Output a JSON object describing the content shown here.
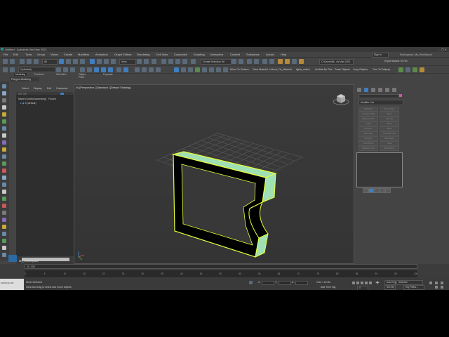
{
  "window": {
    "title": "Untitled - Autodesk 3ds Max 2021",
    "controls": "–  ❐  ✕"
  },
  "menu": {
    "items": [
      "File",
      "Edit",
      "Tools",
      "Group",
      "Views",
      "Create",
      "Modifiers",
      "Animation",
      "Graph Editors",
      "Rendering",
      "Civil View",
      "Customize",
      "Scripting",
      "Interactive",
      "Content",
      "Substance",
      "Arnold",
      "Help"
    ],
    "sign_in": "Sign In",
    "workspaces_label": "Workspaces:",
    "workspace_value": "My_WorkSpace"
  },
  "toolbar": {
    "layer_dropdown": "0 (default)",
    "selection_filter": "All",
    "view_dropdown": "View",
    "create_selection_set": "Create Selection Se",
    "mirror_to_surface": "Mirror To Surface",
    "clear_material": "Clear Material",
    "uvmap_fix": "Unlock_Fix_Material",
    "lights_switch": "lights_switch",
    "unhide_by_pick": "UnHide By Pick",
    "paste_objects": "Paste Objects",
    "copy_objects": "Copy Objects",
    "turn_to_editpoly": "Turn To Editpoly",
    "path_dropdown": "C:\\Users\\Mr...ds Max 2021",
    "export_assets": "Export Assets To Fbx"
  },
  "ribbon": {
    "tabs": [
      "Modeling",
      "Freeform",
      "Selection",
      "Object Paint",
      "Populate"
    ],
    "active_tab": "Modeling",
    "sub_label": "Polygon Modeling"
  },
  "scene_explorer": {
    "tabs": [
      "Select",
      "Display",
      "Edit",
      "Customize"
    ],
    "header_name": "Name (Sorted Ascending)",
    "header_frozen": "Frozen",
    "rows": [
      "0 (default)"
    ],
    "workspace": "My_WorkSpace"
  },
  "viewport": {
    "label": "[+] [Perspective ] [Standard ] [Default Shading ]"
  },
  "command_panel": {
    "modifier_list": "Modifier List",
    "buttons": [
      "Edit Poly",
      "Turn Selec",
      "Unwrap UVW",
      "Shell",
      "Edit Normals",
      "Extrude",
      "Lathe",
      "Bend",
      "Chamfer",
      "Taper",
      "Symmetry",
      "TurboSmooth",
      "Morpher",
      "Edit Mesh",
      "Uvw Xform",
      "Twist",
      "Selection Set",
      "FFD 2x2x2"
    ]
  },
  "timeline": {
    "slider": "0 / 100",
    "ticks": [
      "0",
      "5",
      "10",
      "15",
      "20",
      "25",
      "30",
      "35",
      "40",
      "45",
      "50",
      "55",
      "60",
      "65",
      "70",
      "75",
      "80",
      "85",
      "90",
      "95",
      "100"
    ]
  },
  "status": {
    "selection": "None Selected",
    "hint": "Click and drag to select and move objects",
    "maxscript": "MAXScript Mi:",
    "x_label": "X:",
    "y_label": "Y:",
    "z_label": "Z:",
    "grid": "Grid = 10.0m",
    "add_time_tag": "Add Time Tag",
    "auto_key": "Auto Key",
    "set_key": "Set Key",
    "selected_dropdown": "Selected",
    "key_filters": "Key Filters...",
    "frame": "0"
  },
  "colors": {
    "object_top": "#9fe0b4",
    "object_front": "#000000",
    "object_outline": "#e8ff3a",
    "grid": "#5b5b5b",
    "accent_blue": "#2c6aa5"
  }
}
